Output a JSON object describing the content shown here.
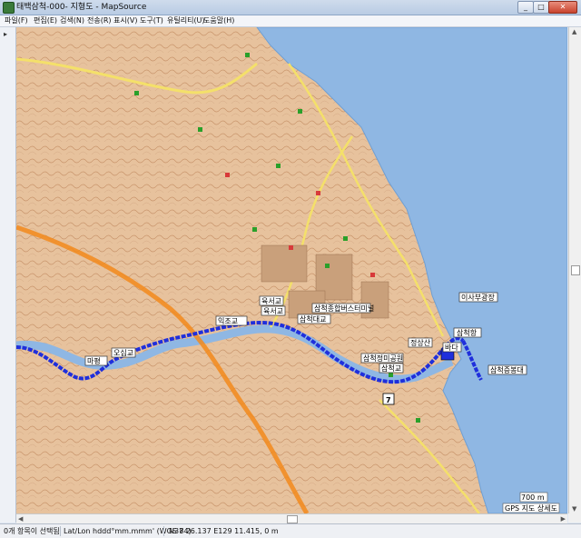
{
  "window": {
    "title": "태백삼척-000- 지형도 - MapSource"
  },
  "menu": [
    "파일(F)",
    "편집(E)",
    "검색(N)",
    "전송(R)",
    "표시(V)",
    "도구(T)",
    "유틸리티(U)",
    "도움말(H)"
  ],
  "map": {
    "labels": {
      "isabu": "이사부광장",
      "samcheokhang": "삼척항",
      "bada": "바다",
      "samcheokjeungsanbong": "삼척증봉대",
      "samcheokjeongmyobi": "삼척정미공원",
      "samcheokgyo": "삼척교",
      "ogeupgyo": "오십교",
      "majeong": "마평",
      "ukseogyo1": "육서교",
      "ukseogyo2": "육서교",
      "ukjinggyo": "익조교",
      "samcheokbus": "삼척종합버스터미널",
      "samcheokbridge": "삼척대교",
      "jeongsan": "정상산",
      "route_number": "7"
    },
    "scale": {
      "distance": "700 m",
      "detail": "GPS 지도 상세도"
    },
    "colors": {
      "water": "#8fb7e3",
      "land": "#e9c6a3",
      "route": "#1f2fdc",
      "highway": "#f28a1c"
    }
  },
  "status": {
    "selection": "0개 항목이 선택됨",
    "format": "Lat/Lon hddd°mm.mmm' (WGS 84)",
    "coords": "N37 26.137 E129 11.415, 0 m"
  }
}
